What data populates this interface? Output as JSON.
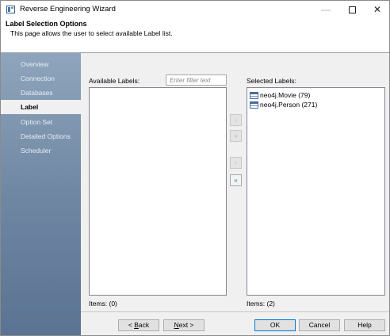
{
  "window": {
    "title": "Reverse Engineering Wizard",
    "minimize_glyph": "—",
    "close_glyph": "✕"
  },
  "header": {
    "title": "Label Selection Options",
    "description": "This page allows the user to select available Label list."
  },
  "sidebar": {
    "items": [
      {
        "label": "Overview",
        "active": false
      },
      {
        "label": "Connection",
        "active": false
      },
      {
        "label": "Databases",
        "active": false
      },
      {
        "label": "Label",
        "active": true
      },
      {
        "label": "Option Set",
        "active": false
      },
      {
        "label": "Detailed Options",
        "active": false
      },
      {
        "label": "Scheduler",
        "active": false
      }
    ]
  },
  "available": {
    "label": "Available Labels:",
    "filter_placeholder": "Enter filter text",
    "items_count": "Items: (0)"
  },
  "selected": {
    "label": "Selected Labels:",
    "items": [
      "neo4j.Movie (79)",
      "neo4j.Person (271)"
    ],
    "items_count": "Items: (2)"
  },
  "transfer": {
    "add_one": "›",
    "add_all": "»",
    "remove_one": "‹",
    "remove_all": "«"
  },
  "footer": {
    "back_pre": "< ",
    "back_key": "B",
    "back_post": "ack",
    "next_key": "N",
    "next_post": "ext >",
    "ok": "OK",
    "cancel": "Cancel",
    "help": "Help"
  },
  "colors": {
    "sidebar_top": "#8fa5bd",
    "sidebar_bottom": "#5b7392",
    "primary_border": "#0078d7",
    "icon_blue": "#4a6a9a"
  }
}
